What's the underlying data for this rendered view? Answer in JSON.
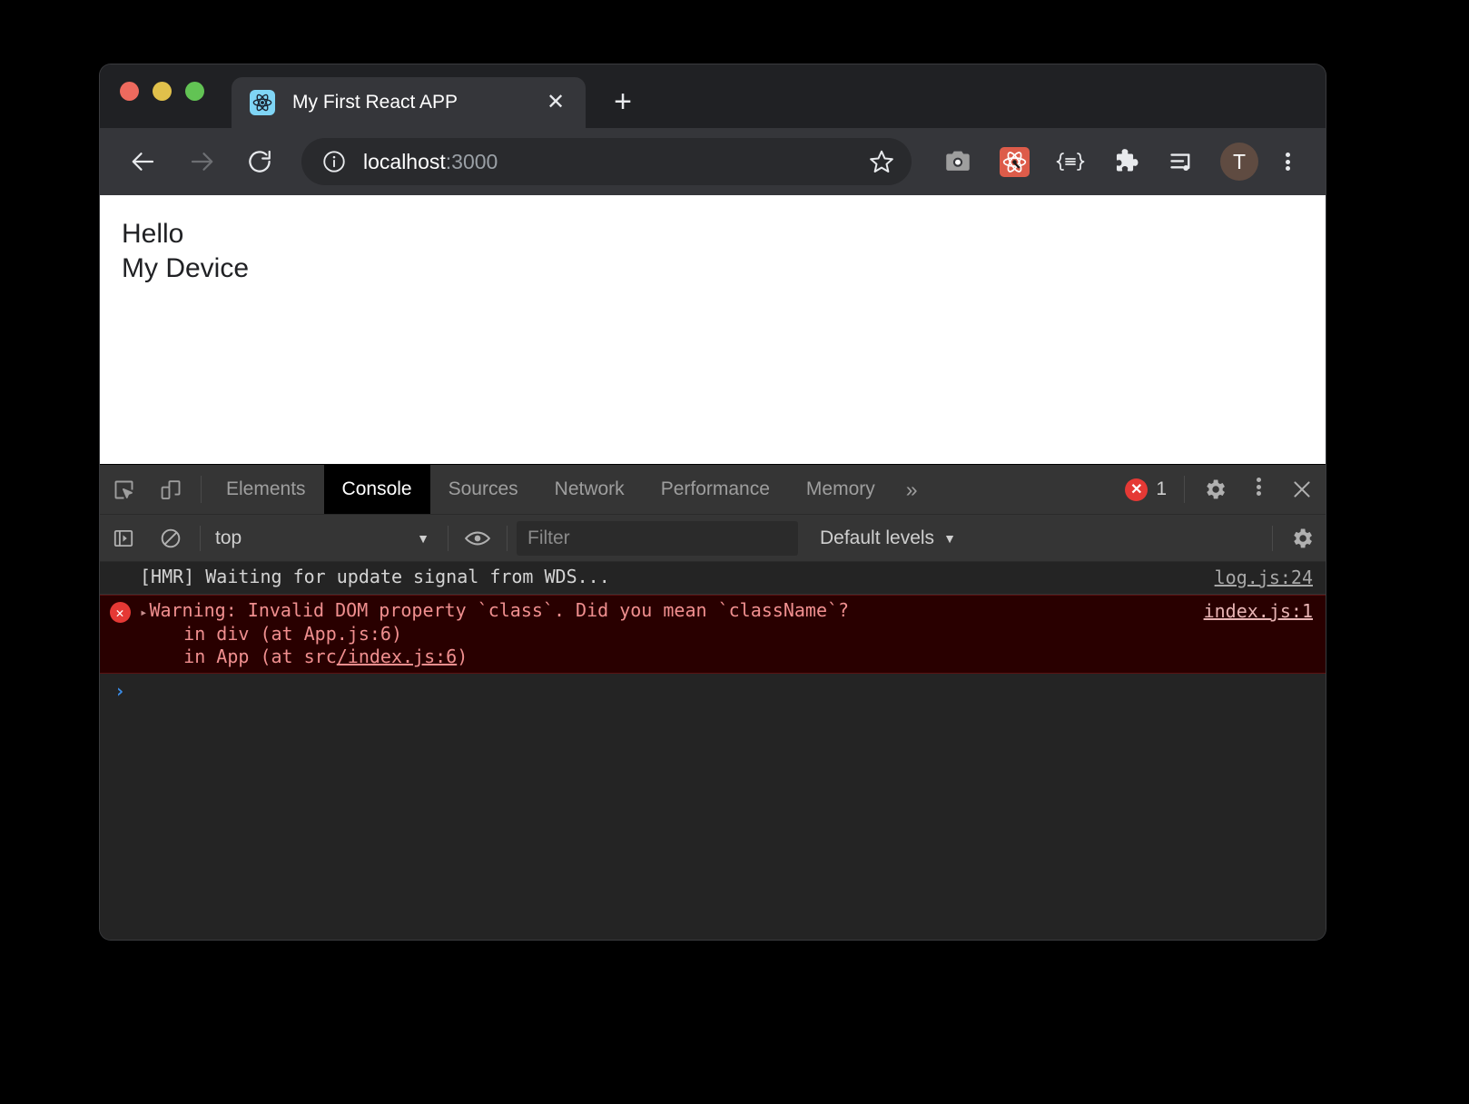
{
  "browser": {
    "window_controls": [
      "close",
      "minimize",
      "maximize"
    ],
    "tab": {
      "title": "My First React APP",
      "favicon": "react-icon",
      "close_label": "✕"
    },
    "new_tab_label": "+",
    "nav": {
      "back": "back-arrow",
      "forward": "forward-arrow",
      "reload": "reload-icon"
    },
    "omnibox": {
      "host": "localhost",
      "rest": ":3000",
      "site_info_icon": "info-icon",
      "bookmark_icon": "star-icon"
    },
    "extensions": [
      {
        "name": "screenshot-camera-icon",
        "glyph": "camera"
      },
      {
        "name": "react-devtools-icon",
        "glyph": "react",
        "color": "#dd5c4a"
      },
      {
        "name": "json-viewer-icon",
        "glyph": "{≡}"
      },
      {
        "name": "extensions-puzzle-icon",
        "glyph": "puzzle"
      },
      {
        "name": "media-playlist-icon",
        "glyph": "playlist"
      }
    ],
    "avatar_initial": "T",
    "menu_icon": "kebab-menu-icon"
  },
  "page": {
    "lines": [
      "Hello",
      "My Device"
    ]
  },
  "devtools": {
    "tools": {
      "inspect_icon": "inspect-element-icon",
      "device_icon": "device-toolbar-icon"
    },
    "tabs": [
      {
        "label": "Elements",
        "active": false
      },
      {
        "label": "Console",
        "active": true
      },
      {
        "label": "Sources",
        "active": false
      },
      {
        "label": "Network",
        "active": false
      },
      {
        "label": "Performance",
        "active": false
      },
      {
        "label": "Memory",
        "active": false
      }
    ],
    "more_tabs_label": "»",
    "error_count": "1",
    "settings_icon": "gear-icon",
    "kebab_icon": "more-options-icon",
    "close_icon": "close-devtools-icon",
    "filterbar": {
      "sidebar_toggle_icon": "console-sidebar-icon",
      "clear_icon": "clear-console-icon",
      "context": "top",
      "context_caret": "▼",
      "live_expression_icon": "eye-icon",
      "filter_placeholder": "Filter",
      "levels_label": "Default levels",
      "levels_caret": "▼",
      "settings_icon": "console-settings-icon"
    },
    "messages": [
      {
        "type": "info",
        "text": "[HMR] Waiting for update signal from WDS...",
        "source": "log.js:24"
      },
      {
        "type": "error",
        "disclosure": "▸",
        "line1": "Warning: Invalid DOM property `class`. Did you mean `className`?",
        "line2": "    in div (at App.js:6)",
        "line3_prefix": "    in App (at src",
        "line3_link": "/index.js:6",
        "line3_suffix": ")",
        "source": "index.js:1"
      }
    ],
    "prompt_symbol": "›"
  }
}
